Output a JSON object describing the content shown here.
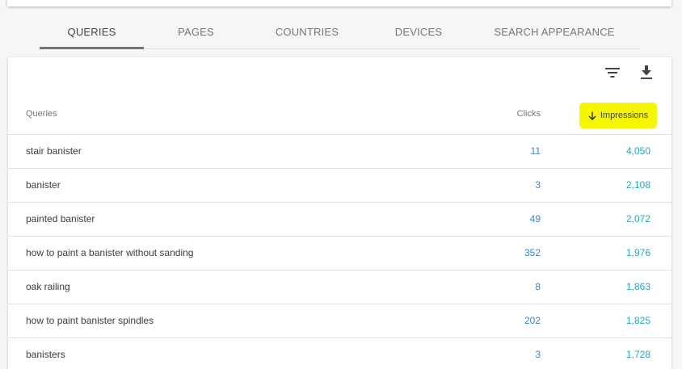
{
  "tabs": [
    {
      "label": "QUERIES",
      "active": true
    },
    {
      "label": "PAGES",
      "active": false
    },
    {
      "label": "COUNTRIES",
      "active": false
    },
    {
      "label": "DEVICES",
      "active": false
    },
    {
      "label": "SEARCH APPEARANCE",
      "active": false
    }
  ],
  "toolbar": {
    "filter_icon": "filter-list-icon",
    "download_icon": "download-icon"
  },
  "table": {
    "headers": {
      "queries": "Queries",
      "clicks": "Clicks",
      "impressions": "Impressions"
    },
    "sort_column": "impressions",
    "sort_direction": "descending",
    "sort_icon": "arrow-down-icon",
    "highlight_color": "#f6f600",
    "rows": [
      {
        "query": "stair banister",
        "clicks": "11",
        "impressions": "4,050"
      },
      {
        "query": "banister",
        "clicks": "3",
        "impressions": "2,108"
      },
      {
        "query": "painted banister",
        "clicks": "49",
        "impressions": "2,072"
      },
      {
        "query": "how to paint a banister without sanding",
        "clicks": "352",
        "impressions": "1,976"
      },
      {
        "query": "oak railing",
        "clicks": "8",
        "impressions": "1,863"
      },
      {
        "query": "how to paint banister spindles",
        "clicks": "202",
        "impressions": "1,825"
      },
      {
        "query": "banisters",
        "clicks": "3",
        "impressions": "1,728"
      }
    ]
  },
  "colors": {
    "clicks": "#3d86c8",
    "impressions": "#25a6bd"
  }
}
